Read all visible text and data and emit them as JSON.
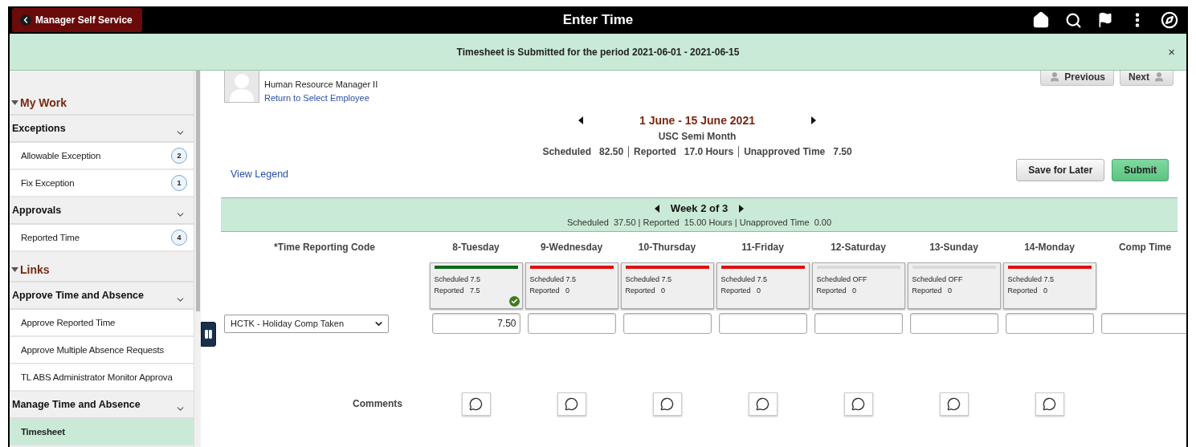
{
  "header": {
    "back_button": "Manager Self Service",
    "title": "Enter Time"
  },
  "banner": {
    "message": "Timesheet is Submitted for the period 2021-06-01 - 2021-06-15",
    "close": "×"
  },
  "sidebar": {
    "sections": [
      {
        "title": "My Work",
        "expanded": true,
        "groups": [
          {
            "title": "Exceptions",
            "expanded": true,
            "items": [
              {
                "label": "Allowable Exception",
                "count": "2",
                "selected": false
              },
              {
                "label": "Fix Exception",
                "count": "1",
                "selected": false
              }
            ]
          },
          {
            "title": "Approvals",
            "expanded": true,
            "items": [
              {
                "label": "Reported Time",
                "count": "4",
                "selected": false
              }
            ]
          }
        ]
      },
      {
        "title": "Links",
        "expanded": true,
        "groups": [
          {
            "title": "Approve Time and Absence",
            "expanded": true,
            "items": [
              {
                "label": "Approve Reported Time",
                "selected": false
              },
              {
                "label": "Approve Multiple Absence Requests",
                "selected": false
              },
              {
                "label": "TL ABS Administrator Monitor Approva",
                "selected": false
              }
            ]
          },
          {
            "title": "Manage Time and Absence",
            "expanded": true,
            "items": [
              {
                "label": "Timesheet",
                "selected": true
              }
            ]
          }
        ]
      }
    ]
  },
  "employee": {
    "job_title": "Human Resource Manager II",
    "return_link": "Return to Select Employee",
    "previous": "Previous",
    "next": "Next"
  },
  "period": {
    "range": "1 June - 15 June 2021",
    "schedule": "USC Semi Month",
    "summary": [
      {
        "label": "Scheduled",
        "value": "82.50"
      },
      {
        "label": "Reported",
        "value": "17.0 Hours"
      },
      {
        "label": "Unapproved Time",
        "value": "7.50"
      }
    ]
  },
  "legend_link": "View Legend",
  "actions": [
    "Save for Later",
    "Submit"
  ],
  "week": {
    "title": "Week 2 of 3",
    "summary": "Scheduled  37.50 | Reported  15.00 Hours | Unapproved Time  0.00"
  },
  "grid": {
    "code_header": "*Time Reporting Code",
    "time_code": "HCTK - Holiday Comp Taken",
    "comments_label": "Comments",
    "days": [
      {
        "label": "8-Tuesday",
        "scheduled": "Scheduled 7.5",
        "reported_label": "Reported",
        "reported": "7.5",
        "color": "#0a6b1a",
        "approved": true,
        "hours": "7.50"
      },
      {
        "label": "9-Wednesday",
        "scheduled": "Scheduled 7.5",
        "reported_label": "Reported",
        "reported": "0",
        "color": "#dd1111",
        "approved": false
      },
      {
        "label": "10-Thursday",
        "scheduled": "Scheduled 7.5",
        "reported_label": "Reported",
        "reported": "0",
        "color": "#dd1111",
        "approved": false
      },
      {
        "label": "11-Friday",
        "scheduled": "Scheduled 7.5",
        "reported_label": "Reported",
        "reported": "0",
        "color": "#dd1111",
        "approved": false
      },
      {
        "label": "12-Saturday",
        "scheduled": "Scheduled OFF",
        "reported_label": "Reported",
        "reported": "0",
        "color": "#dadada",
        "approved": false
      },
      {
        "label": "13-Sunday",
        "scheduled": "Scheduled OFF",
        "reported_label": "Reported",
        "reported": "0",
        "color": "#dadada",
        "approved": false
      },
      {
        "label": "14-Monday",
        "scheduled": "Scheduled 7.5",
        "reported_label": "Reported",
        "reported": "0",
        "color": "#dd1111",
        "approved": false
      }
    ],
    "extra_column": "Comp Time"
  }
}
